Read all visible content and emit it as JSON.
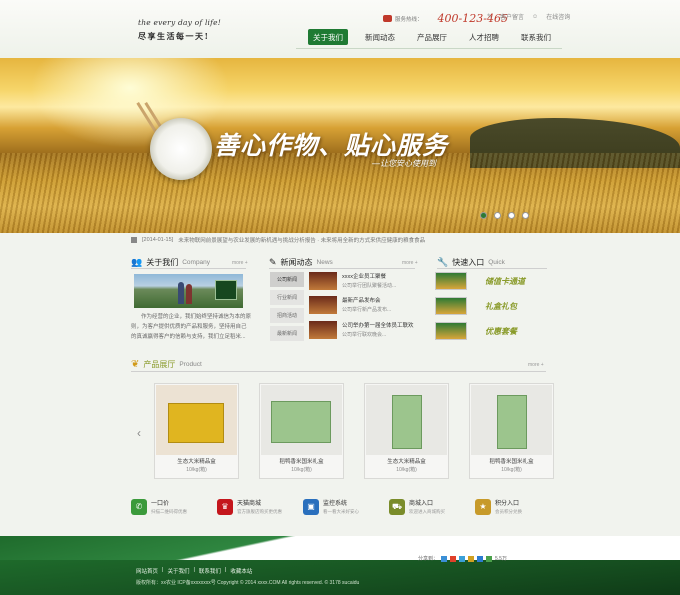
{
  "header": {
    "tagline_en": "the every day of life!",
    "tagline_cn": "尽享生活每一天!",
    "hotline_label": "服务热线：",
    "hotline_number": "400-123-465",
    "top_links": [
      "客户留言",
      "在线咨询"
    ]
  },
  "nav": {
    "items": [
      {
        "label": "关于我们",
        "active": true
      },
      {
        "label": "新闻动态",
        "active": false
      },
      {
        "label": "产品展厅",
        "active": false
      },
      {
        "label": "人才招聘",
        "active": false
      },
      {
        "label": "联系我们",
        "active": false
      }
    ]
  },
  "banner": {
    "slogan": "善心作物、贴心服务",
    "subslogan": "—让您安心使用到",
    "slides": 4,
    "active_slide": 1
  },
  "ticker": {
    "date": "[2014-01-15]",
    "text": "未来物联网前景展望与农业发展的新机遇与挑战分析报告 · 未来将用全新的方式来供应健康的粮食食品"
  },
  "about": {
    "title": "关于我们",
    "title_en": "Company",
    "more": "more +",
    "text": "作为经营的企业，我们始终坚持诚信为本的原则，为客户提供优质的产品和服务，坚持用自己的真诚赢得客户的信赖与支持，我们立足稻米..."
  },
  "news": {
    "title": "新闻动态",
    "title_en": "News",
    "more": "more +",
    "tabs": [
      "公司新闻",
      "行业新闻",
      "招商活动",
      "最新新闻"
    ],
    "active_tab": 0,
    "items": [
      {
        "headline": "xxxx企业员工聚餐",
        "desc": "公司举行团队聚餐活动..."
      },
      {
        "headline": "最新产品发布会",
        "desc": "公司举行新产品发布..."
      },
      {
        "headline": "公司举办第一届全体员工联欢",
        "desc": "公司举行联欢晚会..."
      }
    ]
  },
  "quick": {
    "title": "快速入口",
    "title_en": "Quick",
    "items": [
      "储值卡通道",
      "礼盒礼包",
      "优惠套餐"
    ]
  },
  "products": {
    "title": "产品展厅",
    "title_en": "Product",
    "more": "more +",
    "items": [
      {
        "name": "生态大米精品盒",
        "weight": "10/kg(箱)"
      },
      {
        "name": "稻鸭香米国米礼盒",
        "weight": "10/kg(箱)"
      },
      {
        "name": "生态大米精品盒",
        "weight": "10/kg(箱)"
      },
      {
        "name": "稻鸭香米国米礼盒",
        "weight": "10/kg(箱)"
      }
    ]
  },
  "services": [
    {
      "title": "一口价",
      "desc": "扫描二维码得优惠",
      "color": "#3b9a3b",
      "icon": "wechat-icon"
    },
    {
      "title": "天猫商城",
      "desc": "官方旗舰店购买更优惠",
      "color": "#c4161c",
      "icon": "tmall-icon"
    },
    {
      "title": "监控系统",
      "desc": "看一看大米好安心",
      "color": "#2a6fbd",
      "icon": "monitor-icon"
    },
    {
      "title": "商城入口",
      "desc": "欢迎进入商城购买",
      "color": "#7a8c2a",
      "icon": "cart-icon"
    },
    {
      "title": "积分入口",
      "desc": "会员积分兑换",
      "color": "#c79a2a",
      "icon": "star-icon"
    }
  ],
  "share": {
    "label": "分享到：",
    "count": "5.5万"
  },
  "footer": {
    "links": [
      "网站首页",
      "关于我们",
      "联系我们",
      "收藏本站"
    ],
    "copyright": "版权所有：xx农业 ICP备xxxxxxxx号 Copyright © 2014 xxxx.COM All rights reserved. © 3178 sucaidu"
  },
  "colors": {
    "brand_green": "#1f7a33",
    "phone_red": "#c0392b",
    "quick_text": "#8a9b2b"
  }
}
